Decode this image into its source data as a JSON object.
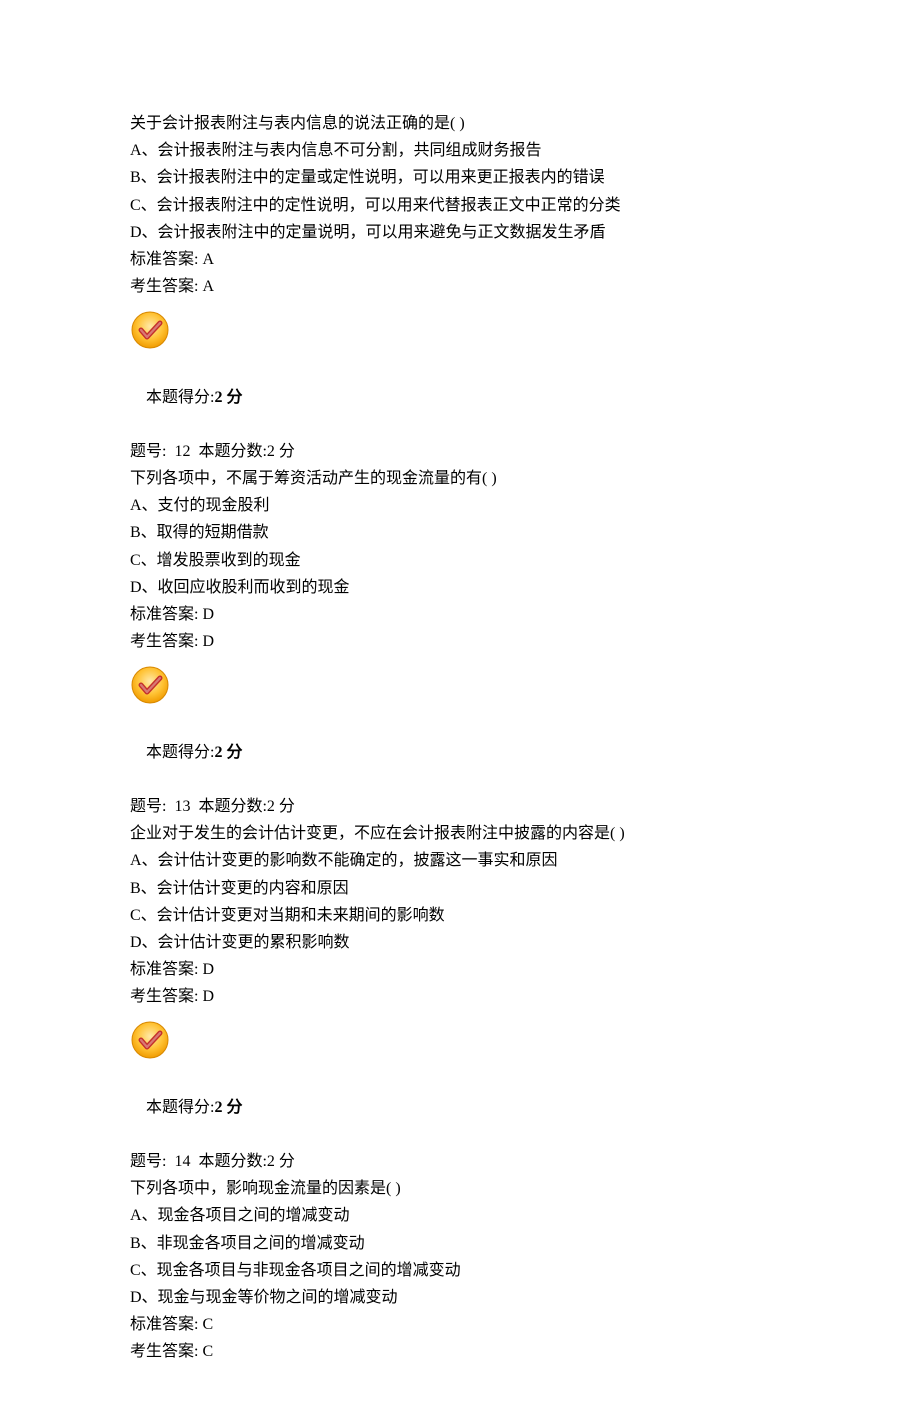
{
  "q11": {
    "stem": "关于会计报表附注与表内信息的说法正确的是( )",
    "optA": "A、会计报表附注与表内信息不可分割，共同组成财务报告",
    "optB": "B、会计报表附注中的定量或定性说明，可以用来更正报表内的错误",
    "optC": "C、会计报表附注中的定性说明，可以用来代替报表正文中正常的分类",
    "optD": "D、会计报表附注中的定量说明，可以用来避免与正文数据发生矛盾",
    "std": "标准答案: A",
    "stu": "考生答案: A",
    "score_label": "本题得分:",
    "score_value": "2 分"
  },
  "q12": {
    "header": "题号:  12  本题分数:2 分",
    "stem": "下列各项中，不属于筹资活动产生的现金流量的有( )",
    "optA": "A、支付的现金股利",
    "optB": "B、取得的短期借款",
    "optC": "C、增发股票收到的现金",
    "optD": "D、收回应收股利而收到的现金",
    "std": "标准答案: D",
    "stu": "考生答案: D",
    "score_label": "本题得分:",
    "score_value": "2 分"
  },
  "q13": {
    "header": "题号:  13  本题分数:2 分",
    "stem": "企业对于发生的会计估计变更，不应在会计报表附注中披露的内容是( )",
    "optA": "A、会计估计变更的影响数不能确定的，披露这一事实和原因",
    "optB": "B、会计估计变更的内容和原因",
    "optC": "C、会计估计变更对当期和未来期间的影响数",
    "optD": "D、会计估计变更的累积影响数",
    "std": "标准答案: D",
    "stu": "考生答案: D",
    "score_label": "本题得分:",
    "score_value": "2 分"
  },
  "q14": {
    "header": "题号:  14  本题分数:2 分",
    "stem": "下列各项中，影响现金流量的因素是( )",
    "optA": "A、现金各项目之间的增减变动",
    "optB": "B、非现金各项目之间的增减变动",
    "optC": "C、现金各项目与非现金各项目之间的增减变动",
    "optD": "D、现金与现金等价物之间的增减变动",
    "std": "标准答案: C",
    "stu": "考生答案: C"
  }
}
